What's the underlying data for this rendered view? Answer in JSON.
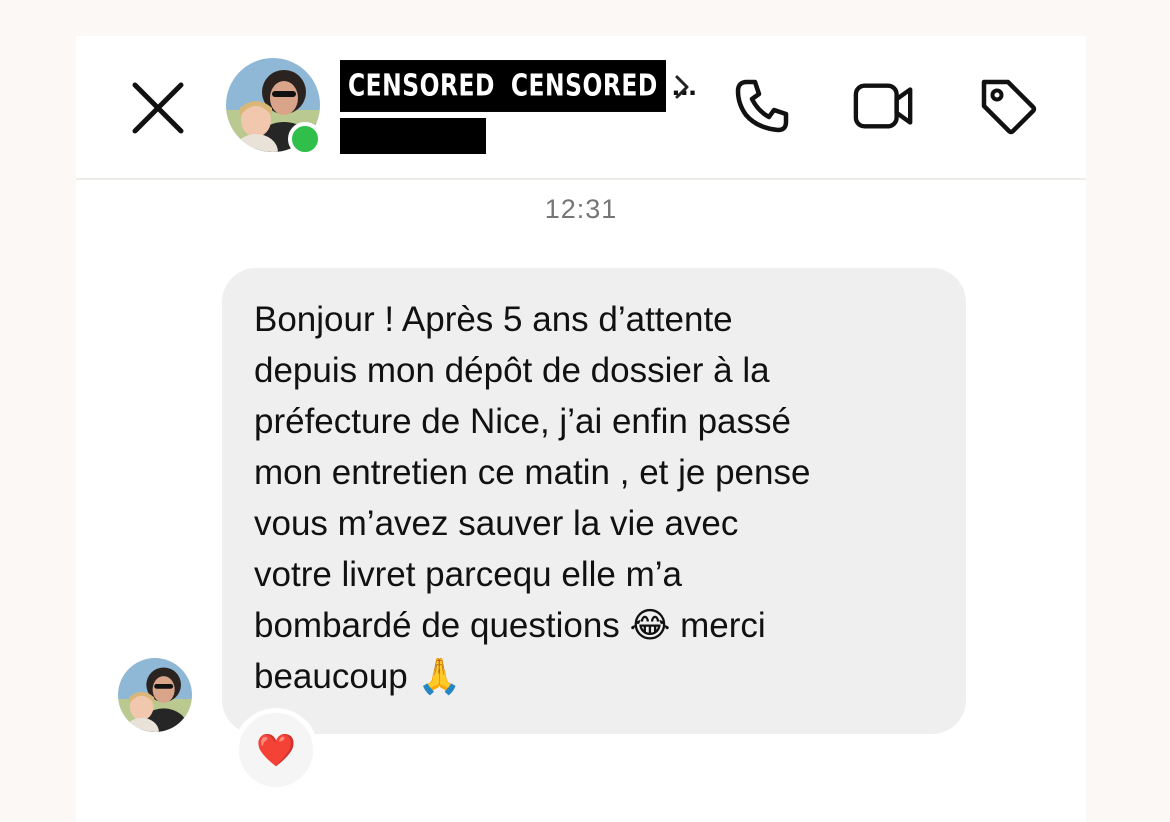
{
  "header": {
    "name_parts": [
      "CENSORED",
      "CENSORED"
    ],
    "name_truncation": "...",
    "subtitle_redacted": "",
    "icons": {
      "close": "close-icon",
      "chevron": "chevron-right-icon",
      "call": "phone-icon",
      "video": "video-call-icon",
      "tag": "tag-icon"
    },
    "online": true
  },
  "thread": {
    "timestamp": "12:31",
    "messages": [
      {
        "sender": "incoming",
        "text": "Bonjour ! Après 5 ans d’attente\ndepuis mon dépôt de dossier à la\npréfecture de Nice, j’ai enfin passé\nmon entretien ce matin , et je pense\nvous m’avez sauver la vie avec\nvotre livret parcequ elle m’a\nbombardé de questions 😂 merci\nbeaucoup 🙏",
        "reaction": "❤️"
      }
    ]
  },
  "colors": {
    "background": "#fcf8f5",
    "card": "#ffffff",
    "bubble": "#efefef",
    "online_dot": "#2fbf4a",
    "timestamp": "#767676"
  }
}
